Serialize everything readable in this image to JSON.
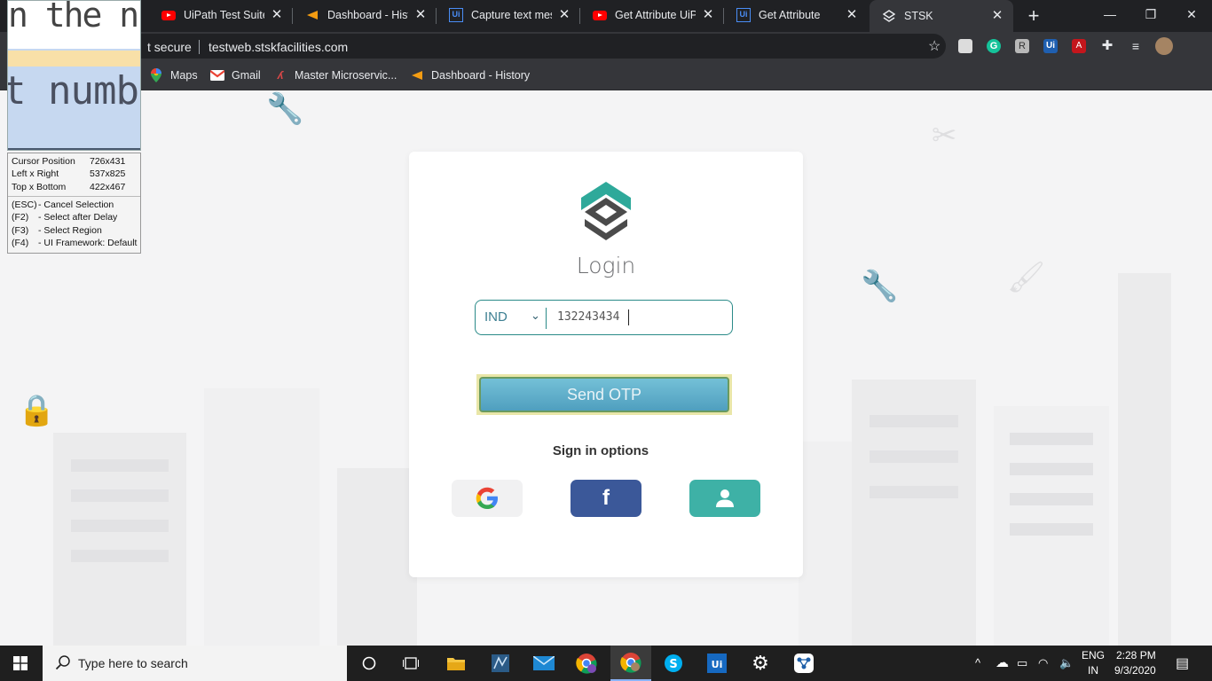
{
  "tabs": [
    {
      "title": "UiPath Test Suite: C",
      "favicon": "youtube-icon",
      "active": false
    },
    {
      "title": "Dashboard - Histo",
      "favicon": "flame-icon",
      "active": false
    },
    {
      "title": "Capture text mess",
      "favicon": "uipath-icon",
      "active": false
    },
    {
      "title": "Get Attribute UiPa",
      "favicon": "youtube-icon",
      "active": false
    },
    {
      "title": "Get Attribute",
      "favicon": "uipath-icon",
      "active": false
    },
    {
      "title": "STSK",
      "favicon": "stsk-icon",
      "active": true
    }
  ],
  "address_bar": {
    "security_label": "t secure",
    "url": "testweb.stskfacilities.com"
  },
  "bookmarks": [
    {
      "label": "Maps",
      "icon": "maps-pin-icon"
    },
    {
      "label": "Gmail",
      "icon": "gmail-icon"
    },
    {
      "label": "Master Microservic...",
      "icon": "microservice-icon"
    },
    {
      "label": "Dashboard - History",
      "icon": "flame-icon"
    }
  ],
  "login": {
    "title": "Login",
    "country_code": "IND",
    "phone_value": "132243434",
    "send_otp_label": "Send OTP",
    "sign_in_options_label": "Sign in options",
    "social_buttons": [
      "google-icon",
      "facebook-icon",
      "user-icon"
    ]
  },
  "selection_overlay": {
    "zoom_top_text": "n the n",
    "zoom_main_text": "t numb",
    "rows": [
      {
        "label": "Cursor Position",
        "value": "726x431"
      },
      {
        "label": "Left x Right",
        "value": "537x825"
      },
      {
        "label": "Top x Bottom",
        "value": "422x467"
      }
    ],
    "shortcuts": [
      {
        "key": "(ESC)",
        "text": "- Cancel Selection"
      },
      {
        "key": "(F2)",
        "text": "- Select after Delay"
      },
      {
        "key": "(F3)",
        "text": "- Select Region"
      },
      {
        "key": "(F4)",
        "text": "- UI Framework: Default"
      }
    ]
  },
  "taskbar": {
    "search_placeholder": "Type here to search",
    "language_line1": "ENG",
    "language_line2": "IN",
    "time": "2:28 PM",
    "date": "9/3/2020"
  },
  "colors": {
    "brand_teal": "#3eb1a6",
    "send_otp_blue": "#5aabca",
    "facebook_blue": "#3b5899",
    "browser_dark": "#202124"
  }
}
